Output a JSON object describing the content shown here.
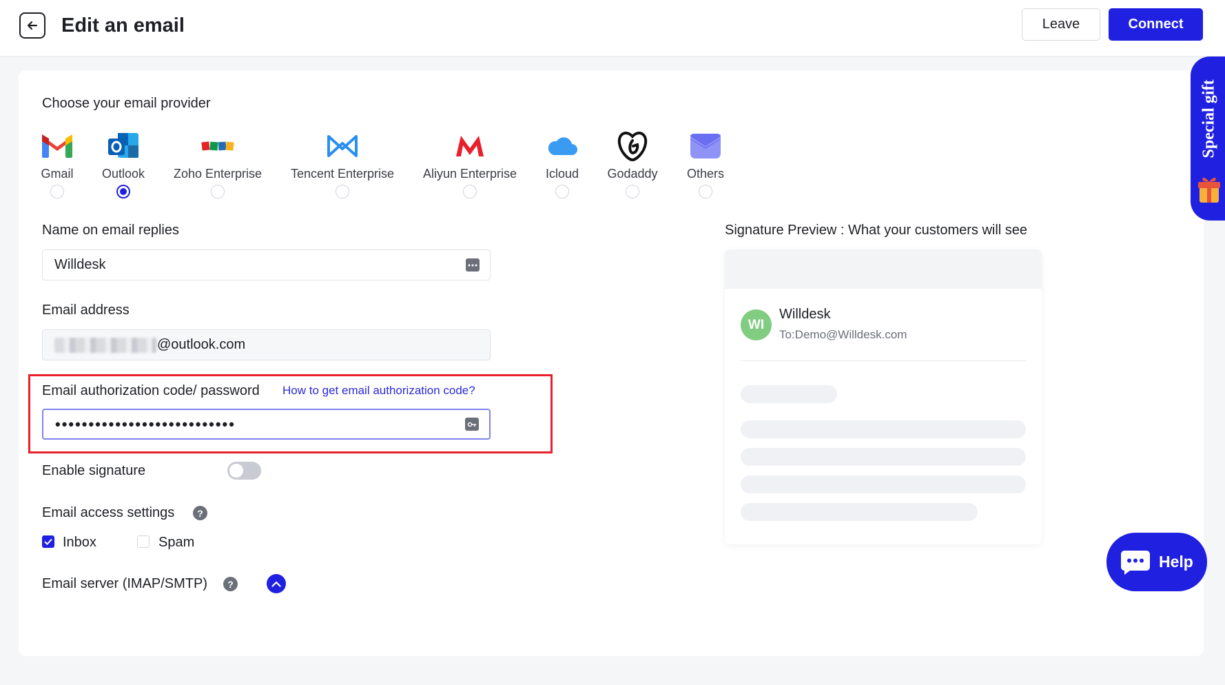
{
  "header": {
    "title": "Edit an email",
    "leave_label": "Leave",
    "connect_label": "Connect"
  },
  "providers": {
    "title": "Choose your email provider",
    "items": [
      {
        "name": "Gmail",
        "icon": "gmail-icon",
        "selected": false
      },
      {
        "name": "Outlook",
        "icon": "outlook-icon",
        "selected": true
      },
      {
        "name": "Zoho Enterprise",
        "icon": "zoho-icon",
        "selected": false
      },
      {
        "name": "Tencent Enterprise",
        "icon": "tencent-icon",
        "selected": false
      },
      {
        "name": "Aliyun Enterprise",
        "icon": "aliyun-icon",
        "selected": false
      },
      {
        "name": "Icloud",
        "icon": "icloud-icon",
        "selected": false
      },
      {
        "name": "Godaddy",
        "icon": "godaddy-icon",
        "selected": false
      },
      {
        "name": "Others",
        "icon": "envelope-icon",
        "selected": false
      }
    ],
    "zoho_logo_text": "ZOHO"
  },
  "form": {
    "name_label": "Name on email replies",
    "name_value": "Willdesk",
    "email_label": "Email address",
    "email_suffix": "@outlook.com",
    "auth_label": "Email authorization code/ password",
    "auth_help_link": "How to get email authorization code?",
    "password_dots": "•••••••••••••••••••••••••••",
    "signature_label": "Enable signature",
    "signature_enabled": false,
    "access_label": "Email access settings",
    "access_help": "?",
    "inbox_label": "Inbox",
    "inbox_checked": true,
    "spam_label": "Spam",
    "spam_checked": false,
    "server_label": "Email server (IMAP/SMTP)",
    "server_help": "?"
  },
  "preview": {
    "title": "Signature Preview : What your customers will see",
    "avatar_initials": "WI",
    "sender_name": "Willdesk",
    "to_line": "To:Demo@Willdesk.com"
  },
  "widgets": {
    "special_gift": "Special gift",
    "help": "Help"
  },
  "colors": {
    "accent": "#2020e0",
    "highlight_frame": "#e8202b",
    "avatar": "#80cc80"
  }
}
